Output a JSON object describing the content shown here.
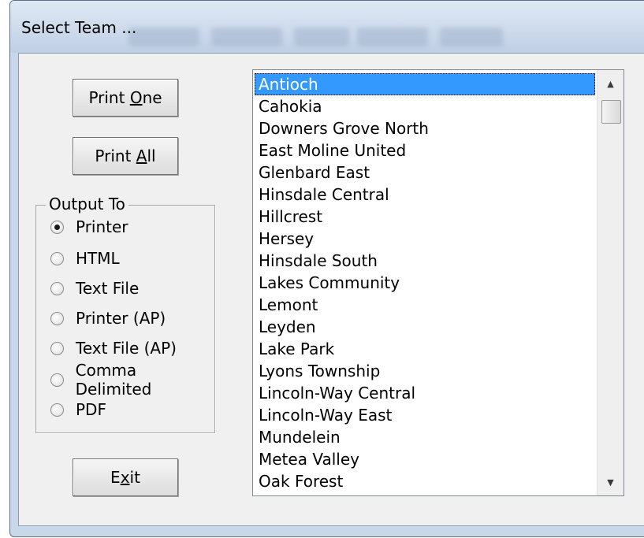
{
  "window": {
    "title": "Select Team ..."
  },
  "buttons": {
    "print_one": {
      "pre": "Print ",
      "accel": "O",
      "post": "ne"
    },
    "print_all": {
      "pre": "Print ",
      "accel": "A",
      "post": "ll"
    },
    "exit": {
      "pre": "E",
      "accel": "x",
      "post": "it"
    }
  },
  "output": {
    "label": "Output To",
    "selected": "Printer",
    "options": [
      "Printer",
      "HTML",
      "Text File",
      "Printer (AP)",
      "Text File (AP)",
      "Comma Delimited",
      "PDF"
    ]
  },
  "teams": {
    "selected": "Antioch",
    "items": [
      "Antioch",
      "Cahokia",
      "Downers Grove North",
      "East Moline United",
      "Glenbard East",
      "Hinsdale Central",
      "Hillcrest",
      "Hersey",
      "Hinsdale South",
      "Lakes Community",
      "Lemont",
      "Leyden",
      "Lake Park",
      "Lyons Township",
      "Lincoln-Way Central",
      "Lincoln-Way East",
      "Mundelein",
      "Metea Valley",
      "Oak Forest"
    ]
  },
  "icons": {
    "up": "scroll-up-arrow-icon",
    "down": "scroll-down-arrow-icon"
  }
}
